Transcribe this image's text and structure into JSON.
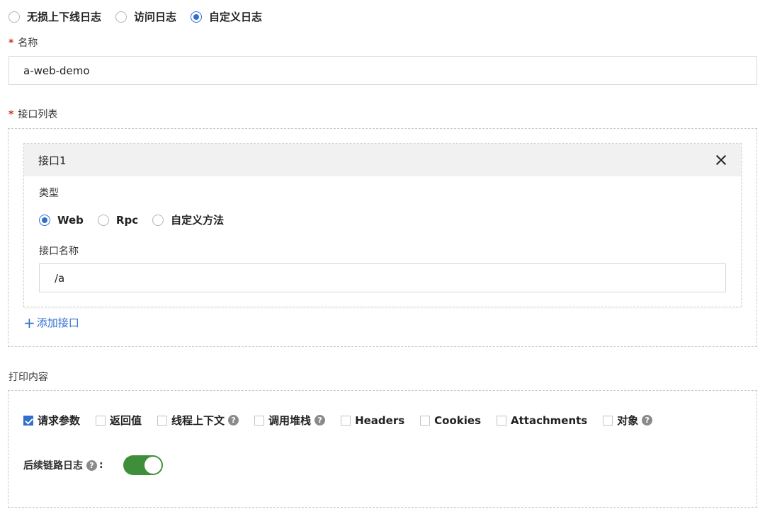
{
  "log_type": {
    "options": [
      "无损上下线日志",
      "访问日志",
      "自定义日志"
    ],
    "selected": "自定义日志"
  },
  "name_field": {
    "label": "名称",
    "required_mark": "*",
    "value": "a-web-demo"
  },
  "interface_list": {
    "label": "接口列表",
    "required_mark": "*",
    "items": [
      {
        "title": "接口1",
        "type_label": "类型",
        "type_options": [
          "Web",
          "Rpc",
          "自定义方法"
        ],
        "type_selected": "Web",
        "name_label": "接口名称",
        "name_value": "/a"
      }
    ],
    "add_label": "添加接口"
  },
  "print_content": {
    "label": "打印内容",
    "options": [
      {
        "label": "请求参数",
        "checked": true,
        "help": false
      },
      {
        "label": "返回值",
        "checked": false,
        "help": false
      },
      {
        "label": "线程上下文",
        "checked": false,
        "help": true
      },
      {
        "label": "调用堆栈",
        "checked": false,
        "help": true
      },
      {
        "label": "Headers",
        "checked": false,
        "help": false
      },
      {
        "label": "Cookies",
        "checked": false,
        "help": false
      },
      {
        "label": "Attachments",
        "checked": false,
        "help": false
      },
      {
        "label": "对象",
        "checked": false,
        "help": true
      }
    ],
    "subsequent_log": {
      "label": "后续链路日志",
      "colon": ":",
      "enabled": true
    }
  },
  "colors": {
    "accent": "#2f6fd0",
    "switch_on": "#3f8f3a",
    "required": "#c8331f"
  },
  "icons": {
    "help": "?",
    "add": "+"
  }
}
